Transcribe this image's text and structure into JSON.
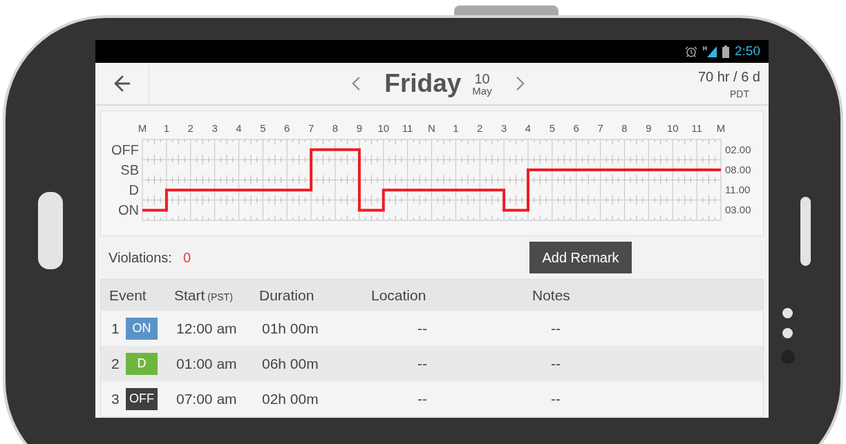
{
  "status_bar": {
    "network": "H",
    "time": "2:50"
  },
  "header": {
    "day": "Friday",
    "date": "10",
    "month": "May",
    "cycle": "70 hr / 6 d",
    "timezone": "PDT"
  },
  "log_graph": {
    "status_labels": [
      "OFF",
      "SB",
      "D",
      "ON"
    ],
    "hour_labels": [
      "M",
      "1",
      "2",
      "3",
      "4",
      "5",
      "6",
      "7",
      "8",
      "9",
      "10",
      "11",
      "N",
      "1",
      "2",
      "3",
      "4",
      "5",
      "6",
      "7",
      "8",
      "9",
      "10",
      "11",
      "M"
    ],
    "totals": [
      "02.00",
      "08.00",
      "11.00",
      "03.00"
    ]
  },
  "violations": {
    "label": "Violations:",
    "count": "0"
  },
  "add_remark": "Add Remark",
  "table": {
    "columns": [
      {
        "label": "Event"
      },
      {
        "label": "Start",
        "note": "(PST)"
      },
      {
        "label": "Duration"
      },
      {
        "label": "Location"
      },
      {
        "label": "Notes"
      }
    ],
    "rows": [
      {
        "index": "1",
        "status": "ON",
        "kind": "on",
        "start": "12:00 am",
        "duration": "01h 00m",
        "location": "--",
        "notes": "--"
      },
      {
        "index": "2",
        "status": "D",
        "kind": "driving",
        "start": "01:00 am",
        "duration": "06h 00m",
        "location": "--",
        "notes": "--"
      },
      {
        "index": "3",
        "status": "OFF",
        "kind": "off",
        "start": "07:00 am",
        "duration": "02h 00m",
        "location": "--",
        "notes": "--"
      }
    ]
  }
}
